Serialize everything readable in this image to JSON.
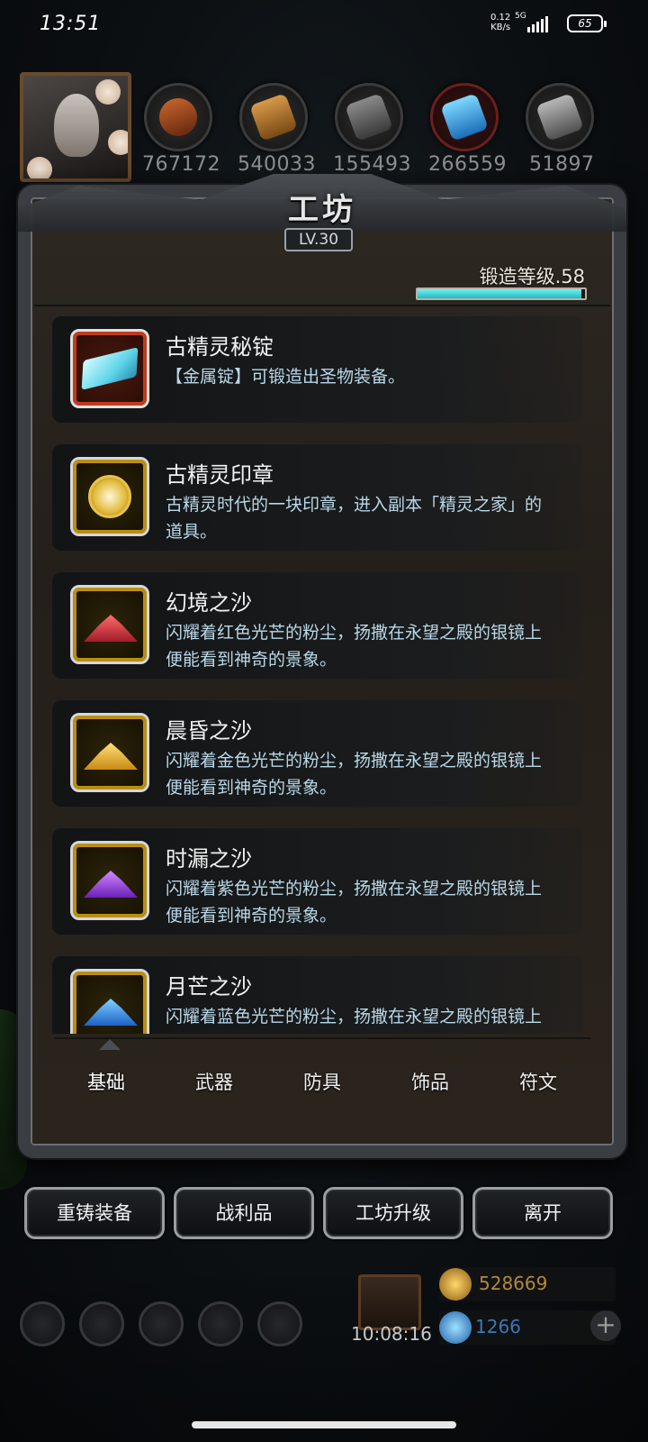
{
  "status_bar": {
    "time": "13:51",
    "net_speed": "0.12",
    "net_unit": "KB/s",
    "signal_type": "5G",
    "battery": "65"
  },
  "resources": [
    "767172",
    "540033",
    "155493",
    "266559",
    "51897"
  ],
  "panel": {
    "title": "工坊",
    "level": "LV.30",
    "forge_level_label": "锻造等级.58",
    "forge_progress": 0.98
  },
  "items": [
    {
      "name": "古精灵秘锭",
      "desc": "【金属锭】可锻造出圣物装备。",
      "icon": "ingot-icon"
    },
    {
      "name": "古精灵印章",
      "desc": "古精灵时代的一块印章，进入副本「精灵之家」的道具。",
      "icon": "seal-icon"
    },
    {
      "name": "幻境之沙",
      "desc": "闪耀着红色光芒的粉尘，扬撒在永望之殿的银镜上便能看到神奇的景象。",
      "icon": "red-sand-icon"
    },
    {
      "name": "晨昏之沙",
      "desc": "闪耀着金色光芒的粉尘，扬撒在永望之殿的银镜上便能看到神奇的景象。",
      "icon": "gold-sand-icon"
    },
    {
      "name": "时漏之沙",
      "desc": "闪耀着紫色光芒的粉尘，扬撒在永望之殿的银镜上便能看到神奇的景象。",
      "icon": "purple-sand-icon"
    },
    {
      "name": "月芒之沙",
      "desc": "闪耀着蓝色光芒的粉尘，扬撒在永望之殿的银镜上便能看到神奇的景象。",
      "icon": "blue-sand-icon"
    }
  ],
  "tabs": [
    "基础",
    "武器",
    "防具",
    "饰品",
    "符文"
  ],
  "actions": [
    "重铸装备",
    "战利品",
    "工坊升级",
    "离开"
  ],
  "hud": {
    "timer": "10:08:16",
    "gold": "528669",
    "gems": "1266"
  },
  "colors": {
    "accent_cyan": "#3fd2dc",
    "gold_text": "#b08a3a",
    "gem_text": "#3a78b8",
    "desc_text": "#b9d8e8"
  }
}
